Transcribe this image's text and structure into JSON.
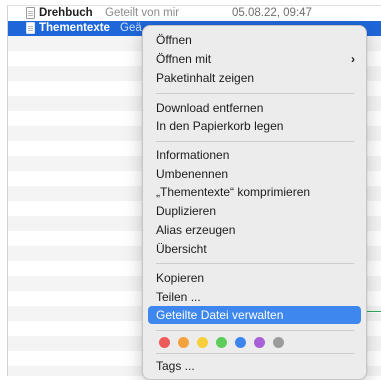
{
  "files": [
    {
      "name": "Drehbuch",
      "sub": "Geteilt von mir",
      "date": "05.08.22, 09:47",
      "selected": false
    },
    {
      "name": "Thementexte",
      "sub": "Geä",
      "date": "",
      "selected": true
    }
  ],
  "menu": {
    "items": {
      "open": "Öffnen",
      "open_with": "Öffnen mit",
      "open_with_chevron": "›",
      "show_package": "Paketinhalt zeigen",
      "remove_download": "Download entfernen",
      "move_to_trash": "In den Papierkorb legen",
      "get_info": "Informationen",
      "rename": "Umbenennen",
      "compress": "„Thementexte“ komprimieren",
      "duplicate": "Duplizieren",
      "make_alias": "Alias erzeugen",
      "quick_look": "Übersicht",
      "copy": "Kopieren",
      "share": "Teilen ...",
      "manage_shared_file": "Geteilte Datei verwalten",
      "tags": "Tags ..."
    },
    "tag_colors": [
      "#ec5a5a",
      "#f3a23c",
      "#f7cf3b",
      "#5ccd5a",
      "#3d86f0",
      "#a760d6",
      "#9b9b9b"
    ],
    "highlight_color": "#3d87ee"
  }
}
